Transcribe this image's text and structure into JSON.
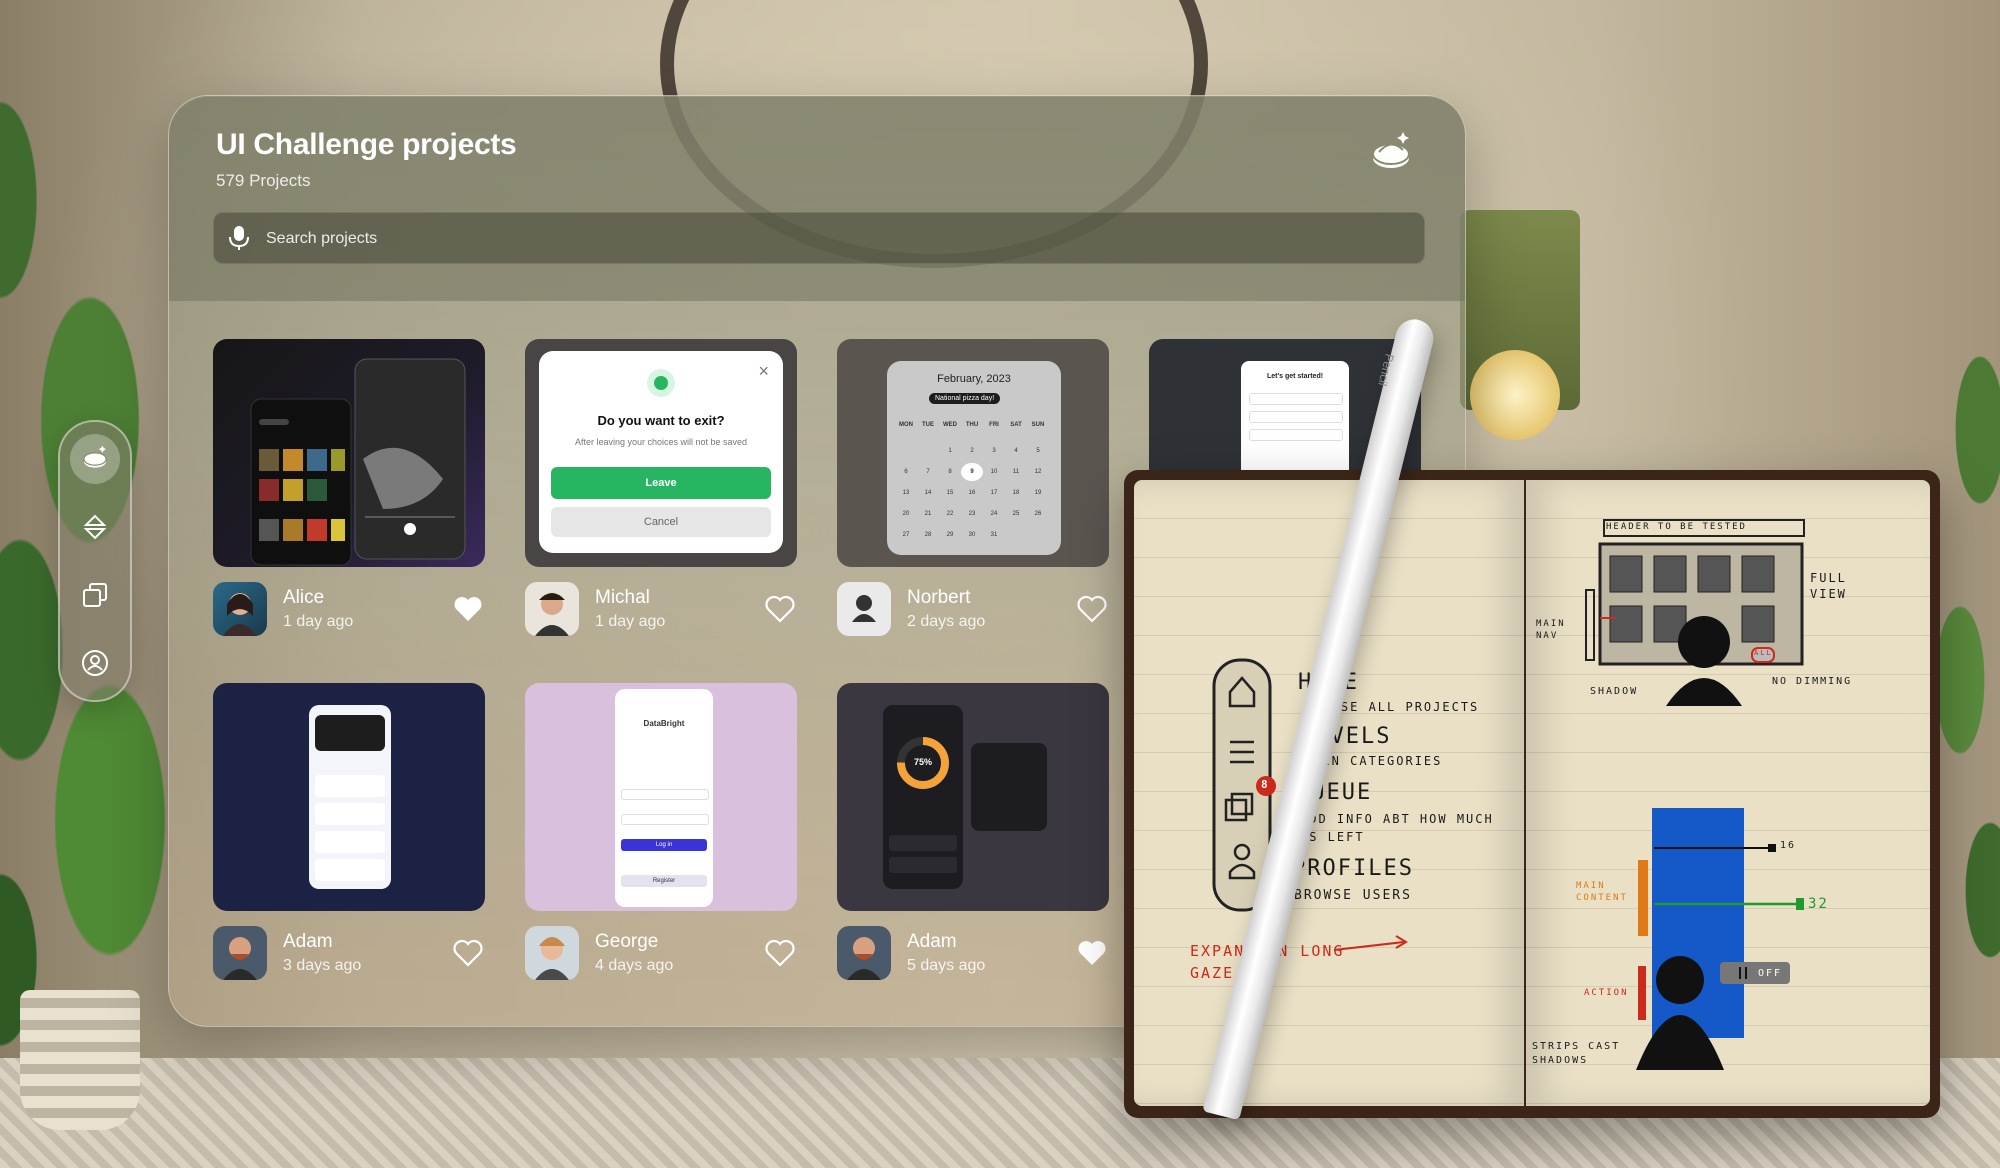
{
  "header": {
    "title": "UI Challenge projects",
    "project_count": "579 Projects",
    "search_placeholder": "Search projects"
  },
  "projects": [
    {
      "name": "Alice",
      "time": "1 day ago",
      "liked": true
    },
    {
      "name": "Michal",
      "time": "1 day ago",
      "liked": false
    },
    {
      "name": "Norbert",
      "time": "2 days ago",
      "liked": false
    },
    {
      "name": "Adam",
      "time": "3 days ago",
      "liked": false
    },
    {
      "name": "George",
      "time": "4 days ago",
      "liked": false
    },
    {
      "name": "Adam",
      "time": "5 days ago",
      "liked": true
    }
  ],
  "thumbs": {
    "dialog": {
      "title": "Do you want to exit?",
      "body": "After leaving your choices will not be saved",
      "primary": "Leave",
      "secondary": "Cancel"
    },
    "calendar": {
      "month": "February, 2023",
      "badge": "National pizza day!",
      "weekdays": [
        "MON",
        "TUE",
        "WED",
        "THU",
        "FRI",
        "SAT",
        "SUN"
      ],
      "days": [
        "1",
        "2",
        "3",
        "4",
        "5",
        "6",
        "7",
        "8",
        "9",
        "10",
        "11",
        "12",
        "13",
        "14",
        "15",
        "16",
        "17",
        "18",
        "19",
        "20",
        "21",
        "22",
        "23",
        "24",
        "25",
        "26",
        "27",
        "28",
        "29",
        "30",
        "31"
      ]
    },
    "signup": {
      "title": "Let's get started!"
    },
    "login": {
      "brand": "DataBright",
      "cta": "Log in",
      "register": "Register"
    },
    "storage": {
      "percent": "75%"
    }
  },
  "notebook": {
    "left_page": {
      "items": [
        {
          "title": "HOME",
          "sub": "BROWSE ALL PROJECTS"
        },
        {
          "title": "LEVELS",
          "sub": "MAIN CATEGORIES"
        },
        {
          "title": "QUEUE",
          "sub": "ADD INFO ABT HOW MUCH IS LEFT"
        },
        {
          "title": "PROFILES",
          "sub": "BROWSE USERS"
        }
      ],
      "badge": "8",
      "note": "EXPAND ON LONG GAZE"
    },
    "right_page": {
      "header_label": "HEADER TO BE TESTED",
      "full_view": "FULL VIEW",
      "main_nav": "MAIN NAV",
      "shadow": "SHADOW",
      "no_dimming": "NO DIMMING",
      "all_label": "ALL",
      "main_content": "MAIN CONTENT",
      "action": "ACTION",
      "off": "OFF",
      "strips": "STRIPS CAST SHADOWS",
      "n16": "16",
      "n32": "32"
    }
  },
  "pencil": {
    "brand": "Pencil"
  },
  "colors": {
    "accent_green": "#27b562",
    "heart": "#ffffff",
    "sketch_red": "#cc2a1b",
    "sketch_blue": "#1459c7",
    "sketch_green": "#1f9a2e",
    "sketch_orange": "#e07a17"
  }
}
